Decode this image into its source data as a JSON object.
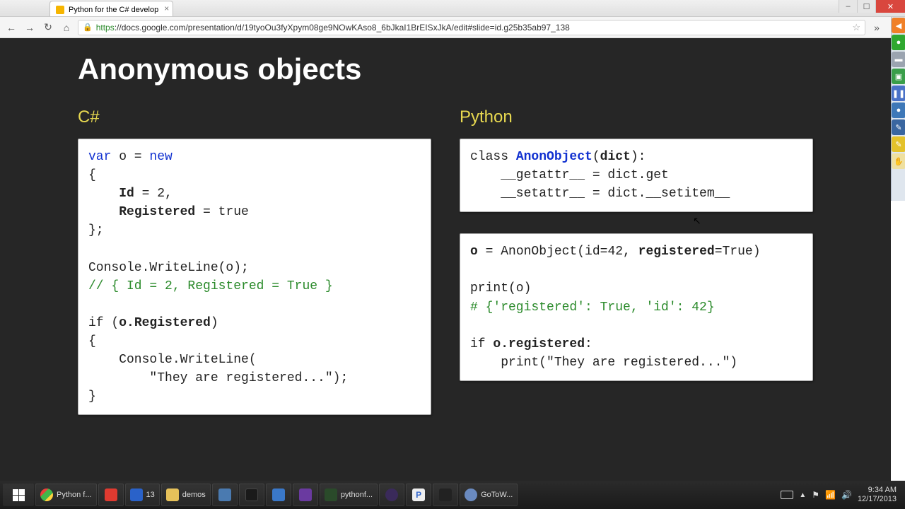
{
  "window": {
    "min": "–",
    "max": "☐",
    "close": "✕"
  },
  "tab": {
    "title": "Python for the C# develop",
    "close": "×"
  },
  "nav": {
    "back": "←",
    "forward": "→",
    "reload": "↻",
    "home": "⌂",
    "lock": "🔒",
    "star": "☆",
    "more": "»",
    "menu": "≡"
  },
  "url": {
    "scheme": "https",
    "rest": "://docs.google.com/presentation/d/19tyoOu3fyXpym08ge9NOwKAso8_6bJkaI1BrEISxJkA/edit#slide=id.g25b35ab97_138"
  },
  "slide": {
    "title": "Anonymous objects",
    "left_heading": "C#",
    "right_heading": "Python"
  },
  "code": {
    "cs_var": "var",
    "cs_o_eq": " o = ",
    "cs_new": "new",
    "cs_brace_open": "{",
    "cs_id_key": "Id",
    "cs_id_rest": " = 2,",
    "cs_reg_key": "Registered",
    "cs_reg_rest": " = true",
    "cs_brace_close": "};",
    "cs_writeline1": "Console.WriteLine(o);",
    "cs_comment": "// { Id = 2, Registered = True }",
    "cs_if_open": "if (",
    "cs_if_expr": "o.Registered",
    "cs_if_close": ")",
    "cs_brace2": "{",
    "cs_writeline2a": "    Console.WriteLine(",
    "cs_writeline2b": "        \"They are registered...\");",
    "cs_brace3": "}",
    "py_class": "class ",
    "py_anon": "AnonObject",
    "py_dict_open": "(",
    "py_dict": "dict",
    "py_dict_close": "):",
    "py_getattr": "    __getattr__ = dict.get",
    "py_setattr": "    __setattr__ = dict.__setitem__",
    "py_o_pre": "o",
    "py_o_mid": " = AnonObject(id=42, ",
    "py_o_reg": "registered",
    "py_o_post": "=True)",
    "py_print1": "print(o)",
    "py_comment": "# {'registered': True, 'id': 42}",
    "py_if_pre": "if ",
    "py_if_expr": "o.registered",
    "py_if_post": ":",
    "py_print2": "    print(\"They are registered...\")"
  },
  "taskbar": {
    "apps": [
      {
        "label": "Python f..."
      },
      {
        "label": ""
      },
      {
        "label": "13"
      },
      {
        "label": "demos"
      },
      {
        "label": ""
      },
      {
        "label": ""
      },
      {
        "label": ""
      },
      {
        "label": ""
      },
      {
        "label": ""
      },
      {
        "label": "pythonf..."
      },
      {
        "label": ""
      },
      {
        "label": "P"
      },
      {
        "label": ""
      },
      {
        "label": "GoToW..."
      }
    ],
    "time": "9:34 AM",
    "date": "12/17/2013",
    "tri": "▲"
  }
}
